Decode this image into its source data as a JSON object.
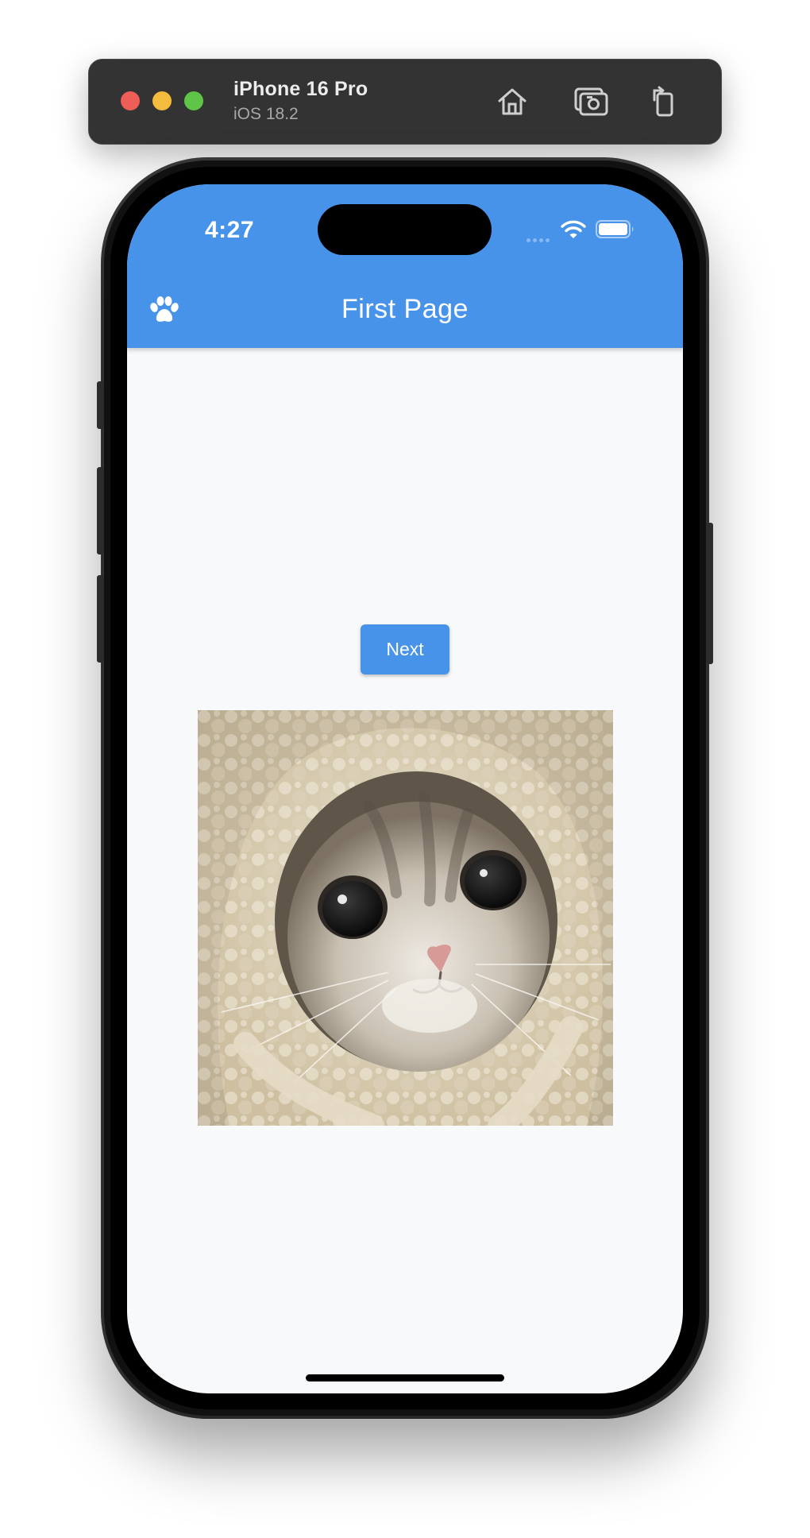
{
  "simulator": {
    "device_name": "iPhone 16 Pro",
    "os_version": "iOS 18.2",
    "toolbar_icons": [
      "home-icon",
      "screenshot-icon",
      "rotate-icon"
    ],
    "traffic_light_colors": [
      "#ee5e56",
      "#f3bc3d",
      "#5ec548"
    ]
  },
  "status_bar": {
    "time": "4:27",
    "icons": [
      "cellular-signal-icon",
      "wifi-icon",
      "battery-icon"
    ]
  },
  "app_bar": {
    "title": "First Page",
    "leading_icon": "paw-icon",
    "color": "#4893ea"
  },
  "body": {
    "next_button_label": "Next",
    "image_icon": "cat-photo"
  },
  "colors": {
    "accent": "#4893ea",
    "background": "#f8f9fb"
  }
}
